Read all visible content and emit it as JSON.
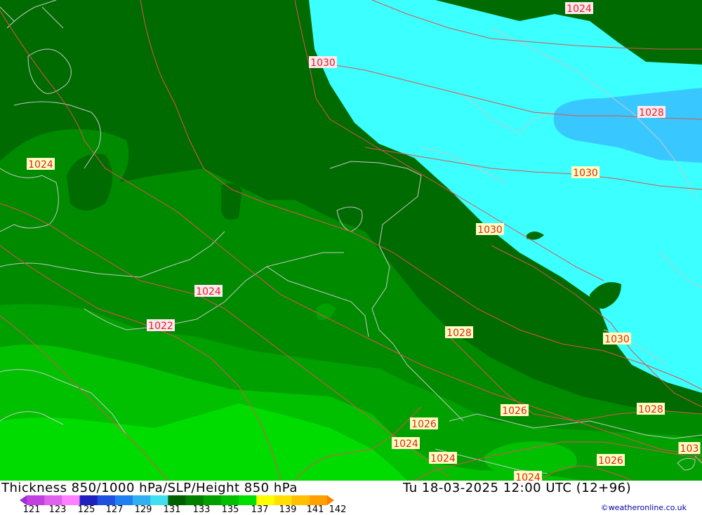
{
  "title": "Thickness 850/1000 hPa/SLP/Height 850 hPa",
  "valid_time": "Tu 18-03-2025 12:00 UTC (12+96)",
  "credit": "©weatheronline.co.uk",
  "legend": {
    "ticks": [
      "121",
      "123",
      "125",
      "127",
      "129",
      "131",
      "133",
      "135",
      "137",
      "139",
      "141",
      "142"
    ],
    "colors": [
      "#9b30d0",
      "#c040e0",
      "#e060f0",
      "#ff80ff",
      "#2020c0",
      "#2050e0",
      "#2080f0",
      "#30b0f0",
      "#40e0f0",
      "#006000",
      "#008000",
      "#00a000",
      "#00c000",
      "#00e000",
      "#ffff00",
      "#ffe000",
      "#ffc000",
      "#ffa000",
      "#ff8000"
    ]
  },
  "map": {
    "contour_labels": [
      {
        "text": "1024"
      },
      {
        "text": "1030"
      },
      {
        "text": "1028"
      },
      {
        "text": "1030"
      },
      {
        "text": "1024"
      },
      {
        "text": "1030"
      },
      {
        "text": "1024"
      },
      {
        "text": "1022"
      },
      {
        "text": "1028"
      },
      {
        "text": "1030"
      },
      {
        "text": "1026"
      },
      {
        "text": "1028"
      },
      {
        "text": "1026"
      },
      {
        "text": "1024"
      },
      {
        "text": "1024"
      },
      {
        "text": "1026"
      },
      {
        "text": "1024"
      },
      {
        "text": "103"
      }
    ],
    "colors": {
      "dark_green": "#006b00",
      "green": "#008a00",
      "mid_green": "#00a000",
      "light_green": "#00c000",
      "bright_green": "#00dc00",
      "cyan": "#3cffff",
      "sky": "#38c8ff",
      "contour": "#e05050",
      "coast": "#c8c8c8"
    }
  }
}
